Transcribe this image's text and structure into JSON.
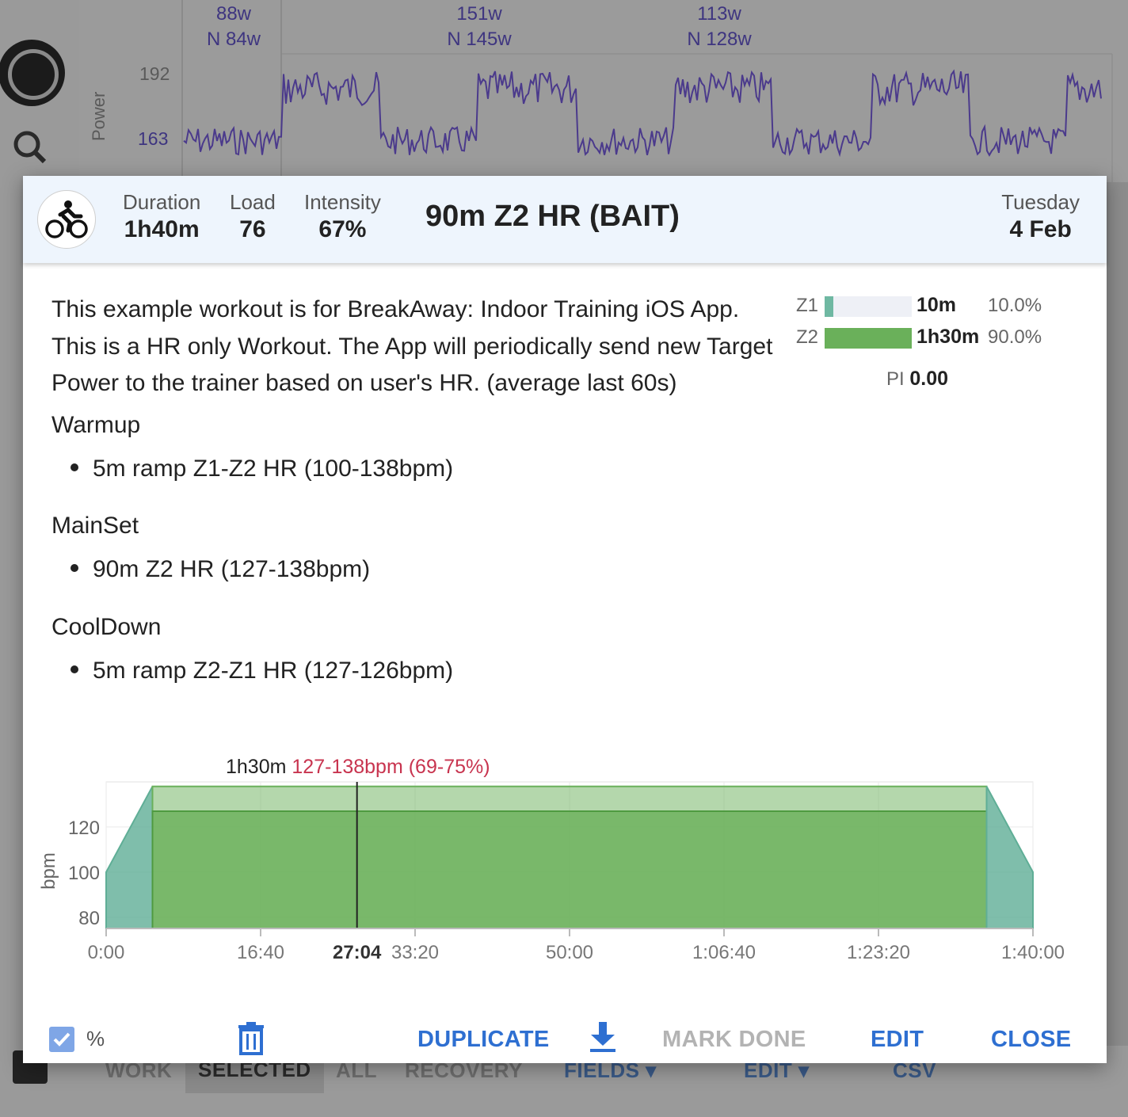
{
  "background": {
    "chart": {
      "y_axis_title": "Power",
      "y_ticks": [
        "192",
        "163"
      ],
      "intervals": [
        {
          "avg": "88w",
          "norm": "N 84w"
        },
        {
          "avg": "151w",
          "norm": "N 145w"
        },
        {
          "avg": "113w",
          "norm": "N 128w"
        }
      ]
    },
    "bottom_tabs": [
      "WORK",
      "SELECTED",
      "ALL",
      "RECOVERY",
      "FIELDS ▾",
      "EDIT ▾",
      "CSV"
    ]
  },
  "workout": {
    "sport_icon": "bike-icon",
    "stats": [
      {
        "label": "Duration",
        "value": "1h40m"
      },
      {
        "label": "Load",
        "value": "76"
      },
      {
        "label": "Intensity",
        "value": "67%"
      }
    ],
    "title": "90m Z2 HR (BAIT)",
    "day": "Tuesday",
    "date": "4 Feb",
    "description": "This example workout is for BreakAway: Indoor Training iOS App. This is a HR only Workout. The App will periodically send new Target Power to the trainer based on user's HR. (average last 60s)",
    "sections": [
      {
        "heading": "Warmup",
        "item": "5m ramp Z1-Z2 HR (100-138bpm)"
      },
      {
        "heading": "MainSet",
        "item": "90m Z2 HR (127-138bpm)"
      },
      {
        "heading": "CoolDown",
        "item": "5m ramp Z2-Z1 HR (127-126bpm)"
      }
    ],
    "zones": [
      {
        "name": "Z1",
        "time": "10m",
        "percent": "10.0%",
        "fraction": 0.1,
        "color": "#6fb8a2"
      },
      {
        "name": "Z2",
        "time": "1h30m",
        "percent": "90.0%",
        "fraction": 1.0,
        "color": "#6ab05a"
      }
    ],
    "pi_label": "PI",
    "pi_value": "0.00"
  },
  "chart_data": {
    "type": "area",
    "ylabel": "bpm",
    "x_unit": "seconds",
    "xlim": [
      0,
      6000
    ],
    "ylim": [
      75,
      140
    ],
    "x_ticks": [
      "0:00",
      "16:40",
      "33:20",
      "50:00",
      "1:06:40",
      "1:23:20",
      "1:40:00"
    ],
    "x_tick_values": [
      0,
      1000,
      2000,
      3000,
      4000,
      5000,
      6000
    ],
    "y_ticks": [
      80,
      100,
      120
    ],
    "cursor": {
      "x": 1624,
      "label": "27:04"
    },
    "hover_label": {
      "duration": "1h30m",
      "range": "127-138bpm (69-75%)"
    },
    "steps": [
      {
        "name": "Warmup",
        "start": 0,
        "end": 300,
        "from_low": 100,
        "to_high": 138,
        "type": "ramp"
      },
      {
        "name": "MainSet",
        "start": 300,
        "end": 5700,
        "low": 127,
        "high": 138,
        "type": "range"
      },
      {
        "name": "CoolDown",
        "start": 5700,
        "end": 6000,
        "from_high": 138,
        "to_low": 100,
        "type": "ramp"
      }
    ],
    "colors": {
      "ramp": "#5fae96",
      "range": "#6ab05a"
    }
  },
  "footer": {
    "percent_label": "%",
    "duplicate": "DUPLICATE",
    "mark_done": "MARK DONE",
    "edit": "EDIT",
    "close": "CLOSE"
  }
}
